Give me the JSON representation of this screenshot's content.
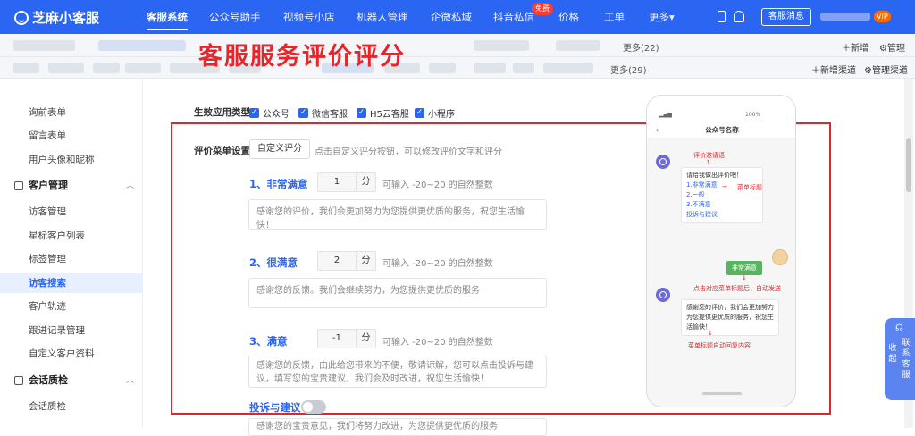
{
  "app": {
    "name": "芝麻小客服"
  },
  "top_nav": [
    {
      "label": "客服系统",
      "active": true
    },
    {
      "label": "公众号助手"
    },
    {
      "label": "视频号小店"
    },
    {
      "label": "机器人管理"
    },
    {
      "label": "企微私域"
    },
    {
      "label": "抖音私信"
    },
    {
      "label": "价格"
    },
    {
      "label": "工单"
    },
    {
      "label": "更多▾"
    }
  ],
  "free_badge": "免费",
  "kefu_msg_button": "客服消息",
  "vip_badge": "VIP",
  "tabs1": {
    "more": "更多(22)",
    "add": "＋新增",
    "manage": "管理"
  },
  "tabs2": {
    "more": "更多(29)",
    "add": "＋新增渠道",
    "manage": "管理渠道"
  },
  "overlay_title": "客服服务评价评分",
  "sidebar": {
    "items_a": [
      {
        "label": "询前表单"
      },
      {
        "label": "留言表单"
      },
      {
        "label": "用户头像和昵称"
      }
    ],
    "group_customer": "客户管理",
    "items_b": [
      {
        "label": "访客管理"
      },
      {
        "label": "星标客户列表"
      },
      {
        "label": "标签管理"
      },
      {
        "label": "访客搜索",
        "active": true
      },
      {
        "label": "客户轨迹"
      },
      {
        "label": "跟进记录管理"
      },
      {
        "label": "自定义客户资料"
      }
    ],
    "group_quality": "会话质检",
    "items_c": [
      {
        "label": "会话质检"
      }
    ]
  },
  "form": {
    "app_type_label": "生效应用类型",
    "app_types": [
      "公众号",
      "微信客服",
      "H5云客服",
      "小程序"
    ],
    "menu_label": "评价菜单设置",
    "custom_button": "自定义评分",
    "custom_hint": "点击自定义评分按钮，可以修改评价文字和评分",
    "levels": [
      {
        "title": "1、非常满意",
        "score": "1",
        "unit": "分",
        "hint": "可输入 -20~20 的自然整数",
        "text": "感谢您的评价，我们会更加努力为您提供更优质的服务，祝您生活愉快！"
      },
      {
        "title": "2、很满意",
        "score": "2",
        "unit": "分",
        "hint": "可输入 -20~20 的自然整数",
        "text": "感谢您的反馈。我们会继续努力，为您提供更优质的服务"
      },
      {
        "title": "3、满意",
        "score": "-1",
        "unit": "分",
        "hint": "可输入 -20~20 的自然整数",
        "text": "感谢您的反馈，由此给您带来的不便，敬请谅解，您可以点击投诉与建议，填写您的宝贵建议，我们会及时改进，祝您生活愉快！"
      }
    ],
    "complaint_label": "投诉与建议",
    "complaint_text": "感谢您的宝贵意见，我们将努力改进，为您提供更优质的服务"
  },
  "phone": {
    "title": "公众号名称",
    "battery": "100%",
    "annot_invite": "评价邀请语",
    "invite_text": "请给我做出评价吧！",
    "options": [
      "1.非常满意",
      "2.一般",
      "3.不满意",
      "投诉与建议"
    ],
    "annot_menu_title": "菜单标题",
    "user_reply": "非常满意",
    "annot_click": "点击对应菜单标题后，自动发送",
    "reply_text": "感谢您的评价，我们会更加努力为您提供更优质的服务，祝您生活愉快！",
    "annot_auto_reply": "菜单标题自动回复内容"
  },
  "float_widget": {
    "left": "收起",
    "right": "联系客服"
  }
}
